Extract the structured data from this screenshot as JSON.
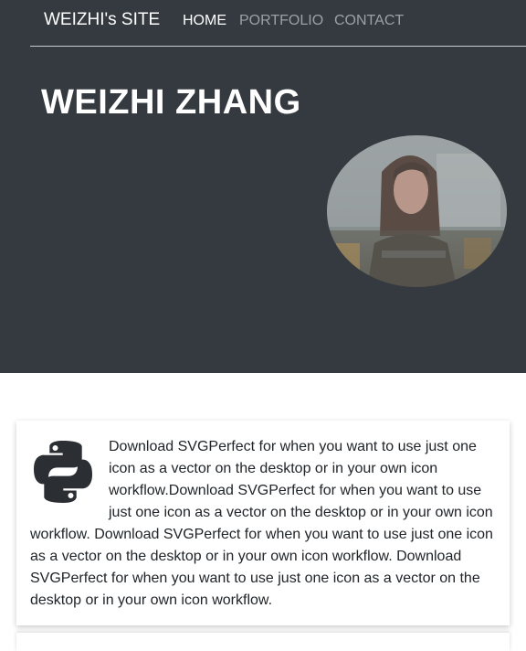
{
  "navbar": {
    "brand": "WEIZHI's SITE",
    "links": [
      {
        "label": "HOME",
        "active": true
      },
      {
        "label": "PORTFOLIO",
        "active": false
      },
      {
        "label": "CONTACT",
        "active": false
      }
    ]
  },
  "hero": {
    "title": "WEIZHI ZHANG",
    "background_color": "#343a40"
  },
  "card": {
    "icon": "python-icon",
    "text": "Download SVGPerfect for when you want to use just one icon as a vector on the desktop or in your own icon workflow.Download SVGPerfect for when you want to use just one icon as a vector on the desktop or in your own icon workflow. Download SVGPerfect for when you want to use just one icon as a vector on the desktop or in your own icon workflow. Download SVGPerfect for when you want to use just one icon as a vector on the desktop or in your own icon workflow."
  }
}
